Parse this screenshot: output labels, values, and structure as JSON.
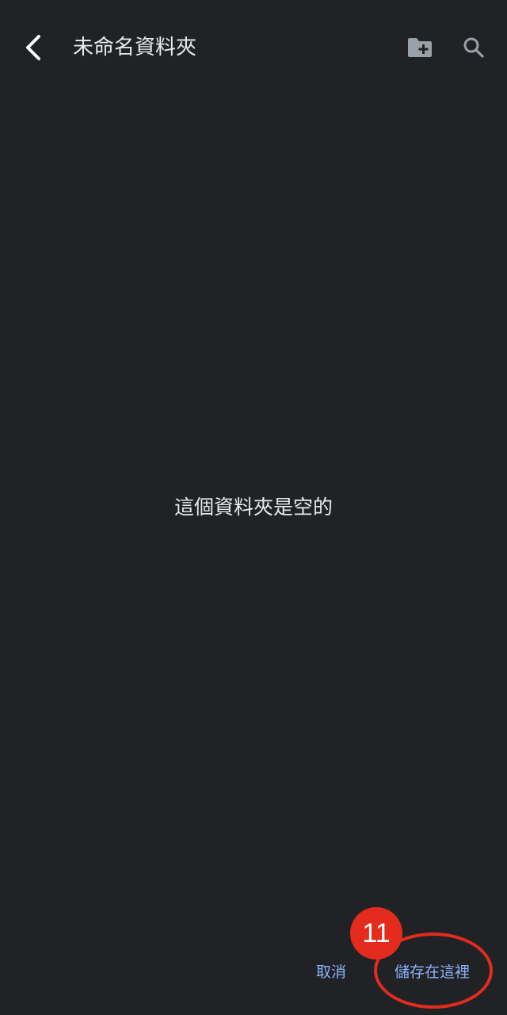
{
  "header": {
    "title": "未命名資料夾",
    "back_icon": "chevron-left-icon",
    "new_folder_icon": "create-new-folder-icon",
    "search_icon": "search-icon"
  },
  "main": {
    "empty_message": "這個資料夾是空的"
  },
  "actions": {
    "cancel_label": "取消",
    "save_label": "儲存在這裡"
  },
  "annotation": {
    "step_number": "11",
    "color": "#e32b1e"
  },
  "colors": {
    "background": "#212226",
    "text": "#e8eaed",
    "accent": "#8ab4f8",
    "icon_gray": "#9aa0a6"
  }
}
